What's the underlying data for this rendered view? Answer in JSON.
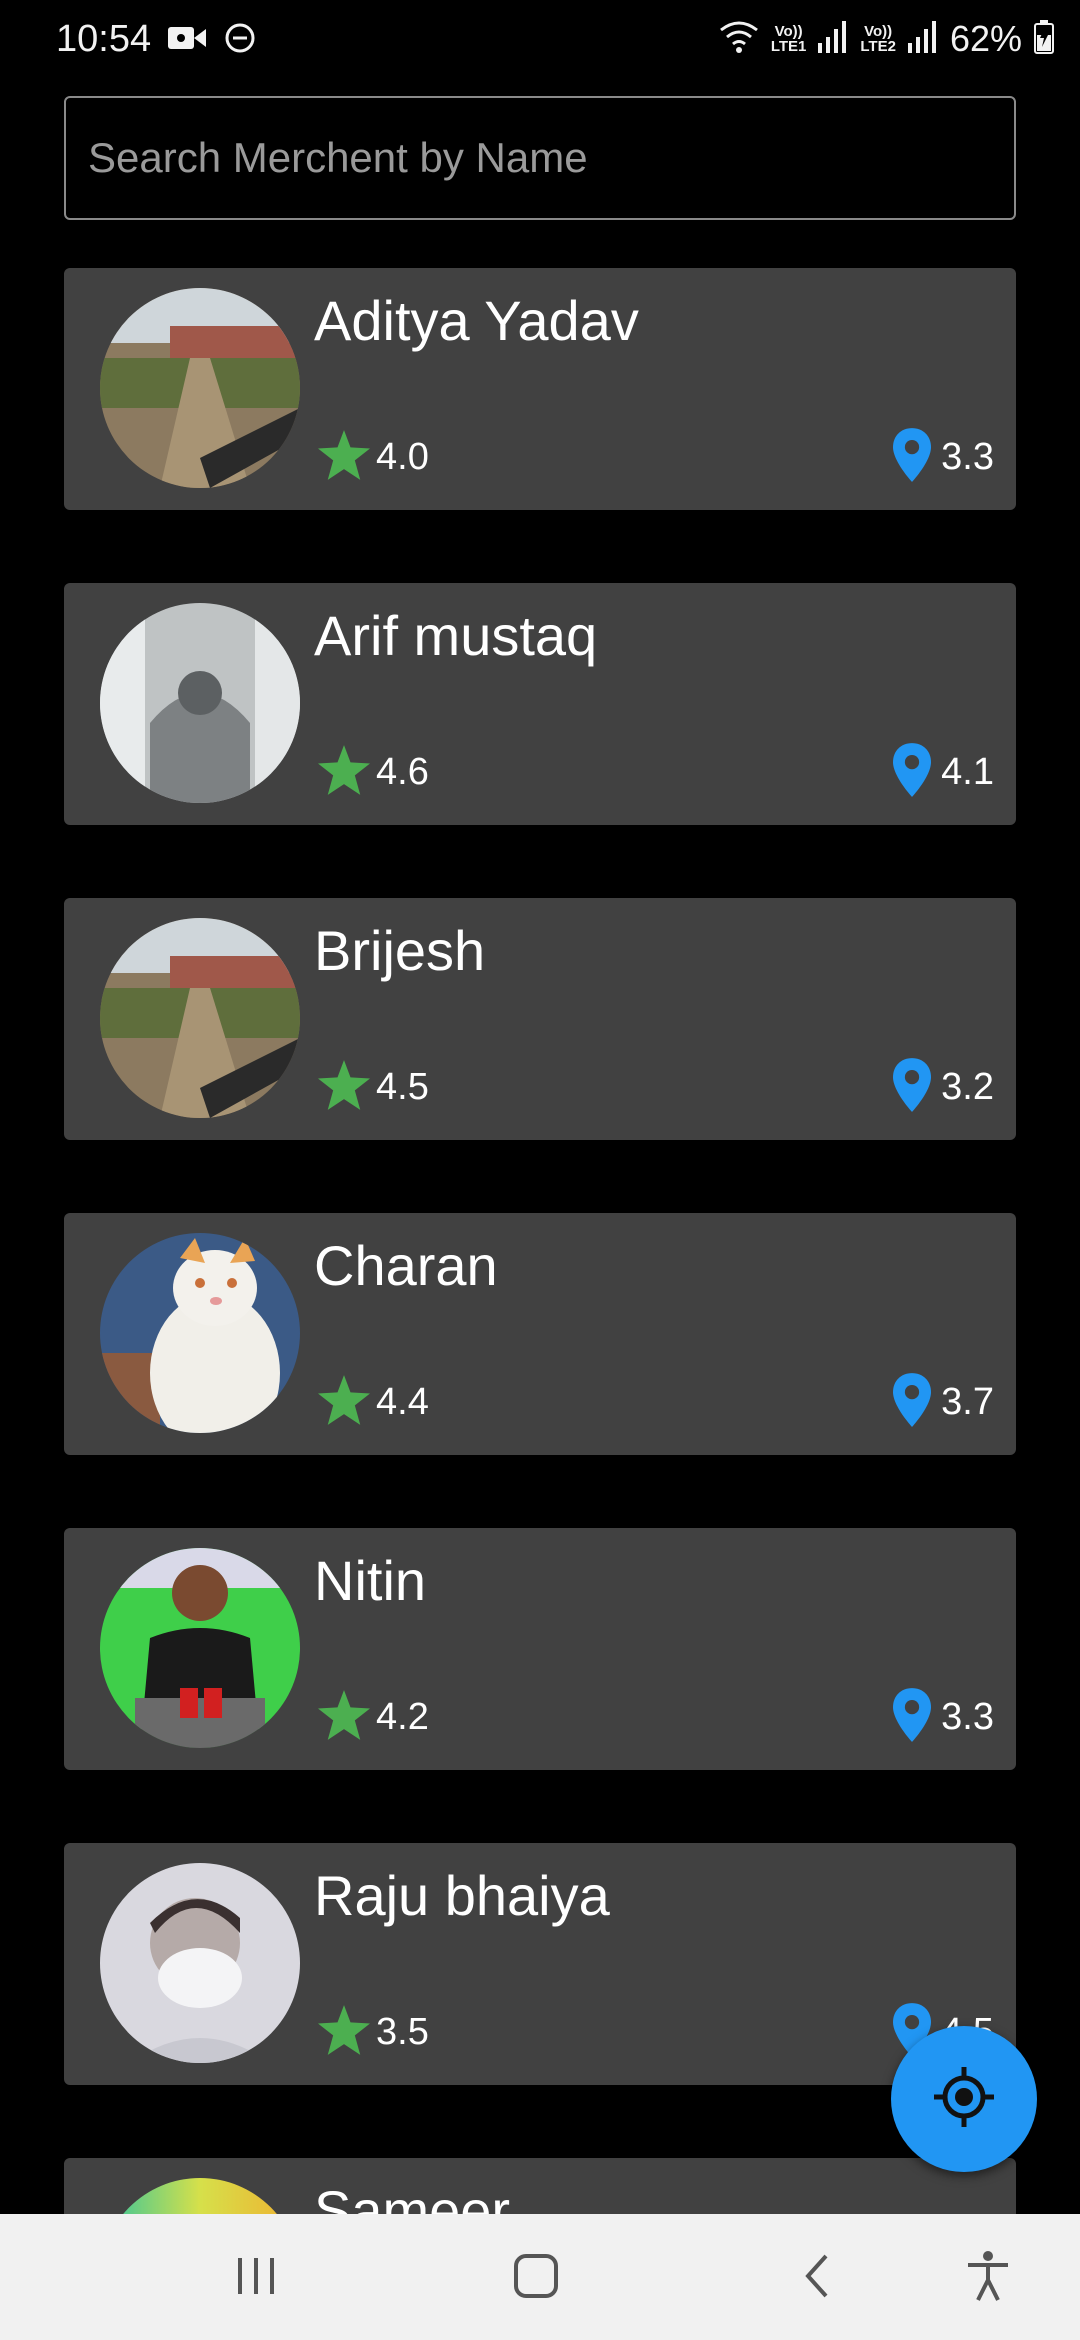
{
  "status_bar": {
    "time": "10:54",
    "network_1": "LTE1",
    "network_2": "LTE2",
    "volte_1": "Vo))",
    "volte_2": "Vo))",
    "battery": "62%"
  },
  "search": {
    "placeholder": "Search Merchent by Name",
    "value": ""
  },
  "merchants": [
    {
      "name": "Aditya Yadav",
      "rating": "4.0",
      "distance": "3.3",
      "avatar": "road-photo"
    },
    {
      "name": "Arif mustaq",
      "rating": "4.6",
      "distance": "4.1",
      "avatar": "vehicle-interior-photo"
    },
    {
      "name": "Brijesh",
      "rating": "4.5",
      "distance": "3.2",
      "avatar": "road-photo"
    },
    {
      "name": "Charan",
      "rating": "4.4",
      "distance": "3.7",
      "avatar": "cat-photo"
    },
    {
      "name": "Nitin",
      "rating": "4.2",
      "distance": "3.3",
      "avatar": "person-with-cups-photo"
    },
    {
      "name": "Raju bhaiya",
      "rating": "3.5",
      "distance": "4.5",
      "avatar": "person-with-mask-photo"
    },
    {
      "name": "Sameer",
      "rating": "",
      "distance": "",
      "avatar": "colorful-photo"
    }
  ],
  "colors": {
    "card": "#414141",
    "star": "#4caf50",
    "pin": "#2196f3",
    "fab": "#2196f3"
  },
  "fab": {
    "icon": "my-location-icon"
  },
  "nav": {
    "icons": [
      "recent-apps-icon",
      "home-icon",
      "back-icon",
      "accessibility-icon"
    ]
  }
}
